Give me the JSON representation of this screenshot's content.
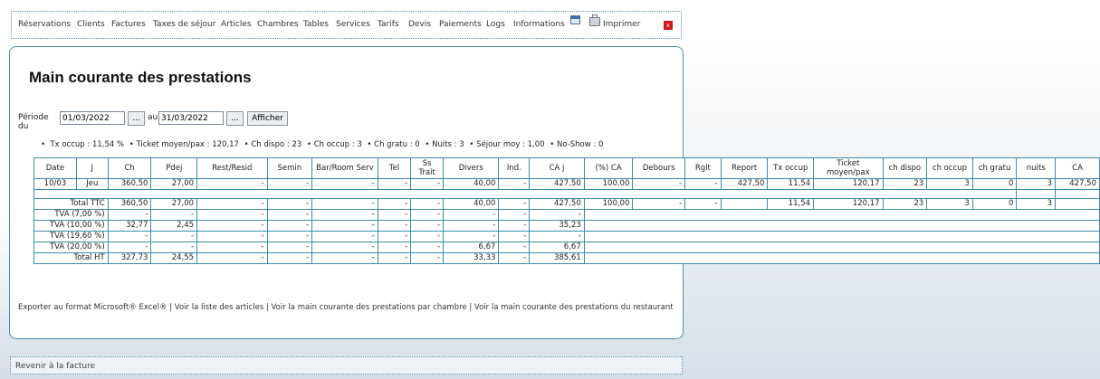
{
  "nav": {
    "items": [
      "Réservations",
      "Clients",
      "Factures",
      "Taxes de séjour",
      "Articles",
      "Chambres",
      "Tables",
      "Services",
      "Tarifs",
      "Devis",
      "Paiements",
      "Logs",
      "Informations"
    ],
    "print_label": "Imprimer",
    "close_label": "x"
  },
  "page": {
    "title": "Main courante des prestations"
  },
  "period": {
    "label": "Période du",
    "from": "01/03/2022",
    "to_label": "au",
    "to": "31/03/2022",
    "picker": "...",
    "show_button": "Afficher"
  },
  "stats": [
    "Tx occup : 11,54 %",
    "Ticket moyen/pax : 120,17",
    "Ch dispo : 23",
    "Ch occup : 3",
    "Ch gratu : 0",
    "Nuits : 3",
    "Séjour moy : 1,00",
    "No-Show : 0"
  ],
  "table": {
    "headers": [
      "Date",
      "J",
      "Ch",
      "Pdej",
      "Rest/Resid",
      "Semin",
      "Bar/Room Serv",
      "Tel",
      "Ss Trait",
      "Divers",
      "Ind.",
      "CA j",
      "(%) CA",
      "Debours",
      "Rglt",
      "Report",
      "Tx occup",
      "Ticket moyen/pax",
      "ch dispo",
      "ch occup",
      "ch gratu",
      "nuits",
      "CA"
    ],
    "day_rows": [
      [
        "10/03",
        "Jeu",
        "360,50",
        "27,00",
        "-",
        "-",
        "-",
        "-",
        "-",
        "40,00",
        "-",
        "427,50",
        "100,00",
        "-",
        "-",
        "427,50",
        "11,54",
        "120,17",
        "23",
        "3",
        "0",
        "3",
        "427,50"
      ]
    ],
    "total_ttc": [
      "Total TTC",
      "360,50",
      "27,00",
      "-",
      "-",
      "-",
      "-",
      "-",
      "40,00",
      "-",
      "427,50",
      "100,00",
      "-",
      "-",
      "",
      "11,54",
      "120,17",
      "23",
      "3",
      "0",
      "3",
      ""
    ],
    "tva_rows": [
      [
        "TVA (7,00 %)",
        "-",
        "-",
        "-",
        "-",
        "-",
        "-",
        "-",
        "-",
        "-",
        "-"
      ],
      [
        "TVA (10,00 %)",
        "32,77",
        "2,45",
        "-",
        "-",
        "-",
        "-",
        "-",
        "-",
        "-",
        "35,23"
      ],
      [
        "TVA (19,60 %)",
        "-",
        "-",
        "-",
        "-",
        "-",
        "-",
        "-",
        "-",
        "-",
        "-"
      ],
      [
        "TVA (20,00 %)",
        "-",
        "-",
        "-",
        "-",
        "-",
        "-",
        "-",
        "6,67",
        "-",
        "6,67"
      ]
    ],
    "total_ht": [
      "Total HT",
      "327,73",
      "24,55",
      "-",
      "-",
      "-",
      "-",
      "-",
      "33,33",
      "-",
      "385,61"
    ]
  },
  "links": [
    "Exporter au format Microsoft® Excel®",
    "Voir la liste des articles",
    "Voir la main courante des prestations par chambre",
    "Voir la main courante des prestations du restaurant"
  ],
  "link_separator": " | ",
  "footer": {
    "back_label": "Revenir à la facture"
  },
  "colors": {
    "border": "#3c8bab",
    "close": "#d0161b"
  }
}
